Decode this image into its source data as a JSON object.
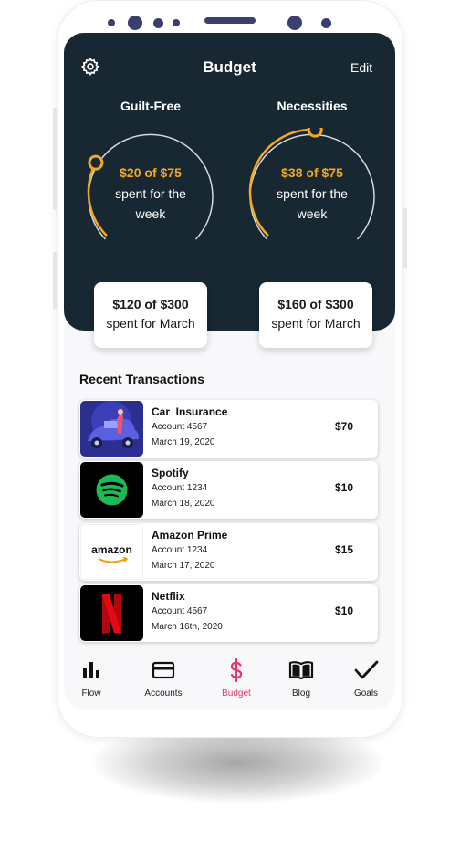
{
  "app": {
    "title": "Budget",
    "edit_label": "Edit"
  },
  "colors": {
    "header_bg": "#172833",
    "accent": "#f5a623",
    "active_nav": "#e8336c"
  },
  "categories": [
    {
      "label": "Guilt-Free",
      "amount": "$20 of $75",
      "sub_line1": "spent for the",
      "sub_line2": "week",
      "progress": 0.27,
      "month": "$120 of $300",
      "month_sub": "spent for March"
    },
    {
      "label": "Necessities",
      "amount": "$38 of $75",
      "sub_line1": "spent for the",
      "sub_line2": "week",
      "progress": 0.51,
      "month": "$160 of $300",
      "month_sub": "spent for March"
    }
  ],
  "transactions_title": "Recent Transactions",
  "transactions": [
    {
      "name": "Car  Insurance",
      "account": "Account 4567",
      "date": "March 19, 2020",
      "amount": "$70",
      "image": "car-insurance-illustration"
    },
    {
      "name": "Spotify",
      "account": "Account 1234",
      "date": "March 18, 2020",
      "amount": "$10",
      "image": "spotify-logo"
    },
    {
      "name": "Amazon Prime",
      "account": "Account 1234",
      "date": "March 17, 2020",
      "amount": "$15",
      "image": "amazon-logo",
      "logo_text": "amazon"
    },
    {
      "name": "Netflix",
      "account": "Account 4567",
      "date": "March 16th, 2020",
      "amount": "$10",
      "image": "netflix-logo"
    }
  ],
  "nav": [
    {
      "label": "Flow",
      "icon": "bar-chart-icon"
    },
    {
      "label": "Accounts",
      "icon": "credit-card-icon"
    },
    {
      "label": "Budget",
      "icon": "dollar-icon",
      "active": true
    },
    {
      "label": "Blog",
      "icon": "book-icon"
    },
    {
      "label": "Goals",
      "icon": "checkmark-icon"
    }
  ]
}
